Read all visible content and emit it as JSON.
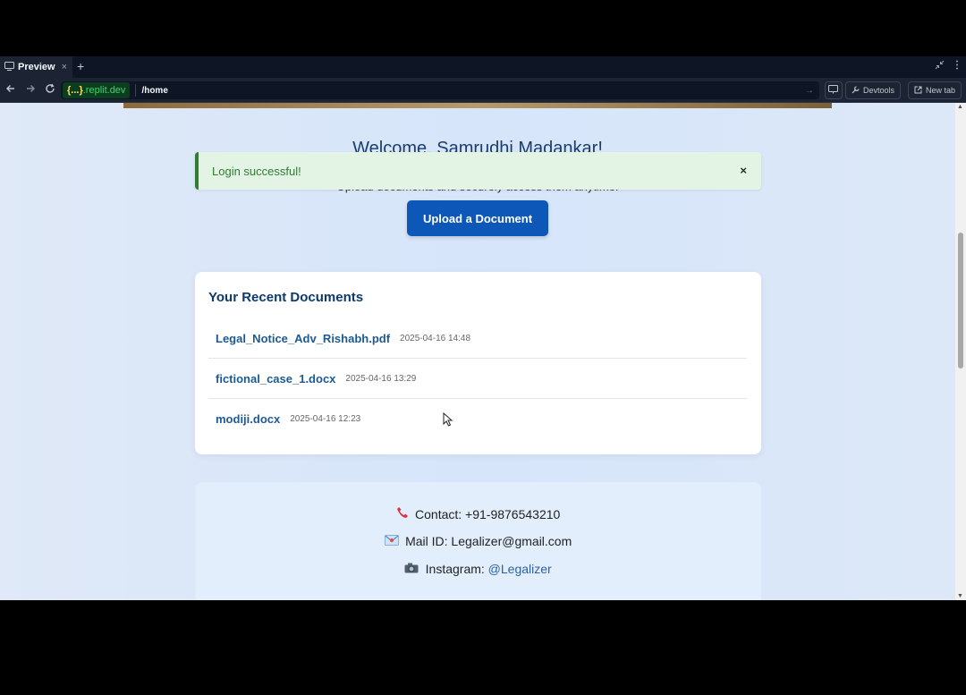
{
  "browser": {
    "tab_label": "Preview",
    "tab_close": "×",
    "tab_add": "+",
    "host_prefix": "{...}",
    "host_domain": ".replit.dev",
    "path": "/home",
    "devtools_label": "Devtools",
    "new_tab_label": "New tab"
  },
  "page": {
    "welcome": "Welcome, Samrudhi Madankar!",
    "subtitle": "Upload documents and securely access them anytime.",
    "alert": {
      "text": "Login successful!",
      "close": "×"
    },
    "upload_label": "Upload a Document"
  },
  "recent_docs": {
    "title": "Your Recent Documents",
    "items": [
      {
        "name": "Legal_Notice_Adv_Rishabh.pdf",
        "date": "2025-04-16 14:48"
      },
      {
        "name": "fictional_case_1.docx",
        "date": "2025-04-16 13:29"
      },
      {
        "name": "modiji.docx",
        "date": "2025-04-16 12:23"
      }
    ]
  },
  "footer": {
    "contact": "Contact: +91-9876543210",
    "mail": "Mail ID: Legalizer@gmail.com",
    "instagram_prefix": "Instagram: ",
    "instagram_handle": "@Legalizer"
  },
  "colors": {
    "primary": "#0d57b8",
    "heading": "#0c3a6b",
    "success": "#2e7d32",
    "link": "#1d5a94"
  }
}
